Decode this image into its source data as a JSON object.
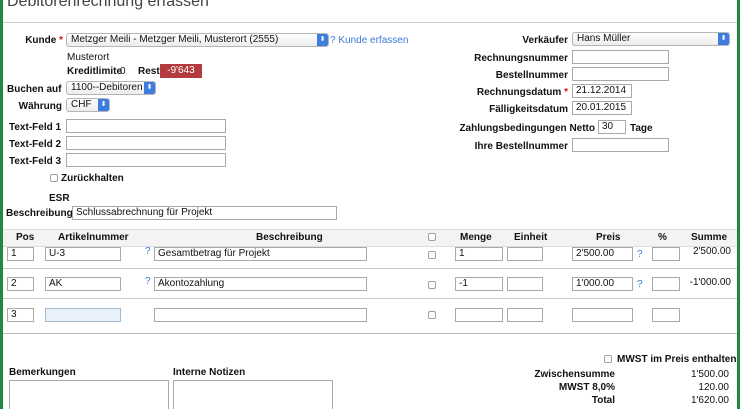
{
  "page_title": "Debitorenrechnung erfassen",
  "left": {
    "kunde_label": "Kunde",
    "kunde_value": "Metzger Meili - Metzger Meili, Musterort (2555)",
    "kunde_link": "? Kunde erfassen",
    "ort": "Musterort",
    "kreditlimite_label": "Kreditlimite",
    "kreditlimite_value": "0",
    "rest_label": "Rest",
    "rest_value": "-9'643",
    "buchen_label": "Buchen auf",
    "buchen_value": "1100--Debitoren",
    "waehrung_label": "Währung",
    "waehrung_value": "CHF",
    "textfeld1_label": "Text-Feld 1",
    "textfeld2_label": "Text-Feld 2",
    "textfeld3_label": "Text-Feld 3",
    "zurueckhalten_label": "Zurückhalten",
    "esr_label": "ESR",
    "beschreibung_label": "Beschreibung",
    "beschreibung_value": "Schlussabrechnung für Projekt"
  },
  "right": {
    "verkaeufer_label": "Verkäufer",
    "verkaeufer_value": "Hans Müller",
    "rechnungsnummer_label": "Rechnungsnummer",
    "bestellnummer_label": "Bestellnummer",
    "rechnungsdatum_label": "Rechnungsdatum",
    "rechnungsdatum_value": "21.12.2014",
    "faelligkeitsdatum_label": "Fälligkeitsdatum",
    "faelligkeitsdatum_value": "20.01.2015",
    "zahlungsbedingungen_label": "Zahlungsbedingungen Netto",
    "zahlungsbedingungen_value": "30",
    "tage_label": "Tage",
    "ihre_bestellnummer_label": "Ihre Bestellnummer"
  },
  "table": {
    "headers": {
      "pos": "Pos",
      "artikelnummer": "Artikelnummer",
      "beschreibung": "Beschreibung",
      "menge": "Menge",
      "einheit": "Einheit",
      "preis": "Preis",
      "prozent": "%",
      "summe": "Summe"
    },
    "help_mark": "?",
    "rows": [
      {
        "pos": "1",
        "artikel": "U-3",
        "beschreibung": "Gesamtbetrag für Projekt",
        "menge": "1",
        "einheit": "",
        "preis": "2'500.00",
        "prozent": "",
        "summe": "2'500.00"
      },
      {
        "pos": "2",
        "artikel": "AK",
        "beschreibung": "Akontozahlung",
        "menge": "-1",
        "einheit": "",
        "preis": "1'000.00",
        "prozent": "",
        "summe": "-1'000.00"
      },
      {
        "pos": "3",
        "artikel": "",
        "beschreibung": "",
        "menge": "",
        "einheit": "",
        "preis": "",
        "prozent": "",
        "summe": ""
      }
    ]
  },
  "bottom": {
    "bemerkungen_label": "Bemerkungen",
    "interne_notizen_label": "Interne Notizen",
    "mwst_checkbox_label": "MWST im Preis enthalten",
    "zwischensumme_label": "Zwischensumme",
    "zwischensumme_value": "1'500.00",
    "mwst_label": "MWST 8,0%",
    "mwst_value": "120.00",
    "total_label": "Total",
    "total_value": "1'620.00"
  },
  "colors": {
    "required": "#d21414",
    "badge": "#b33a3e",
    "link": "#3c7ad6",
    "select_arrow": "#3d7de0",
    "frame": "#1e8a3a"
  }
}
